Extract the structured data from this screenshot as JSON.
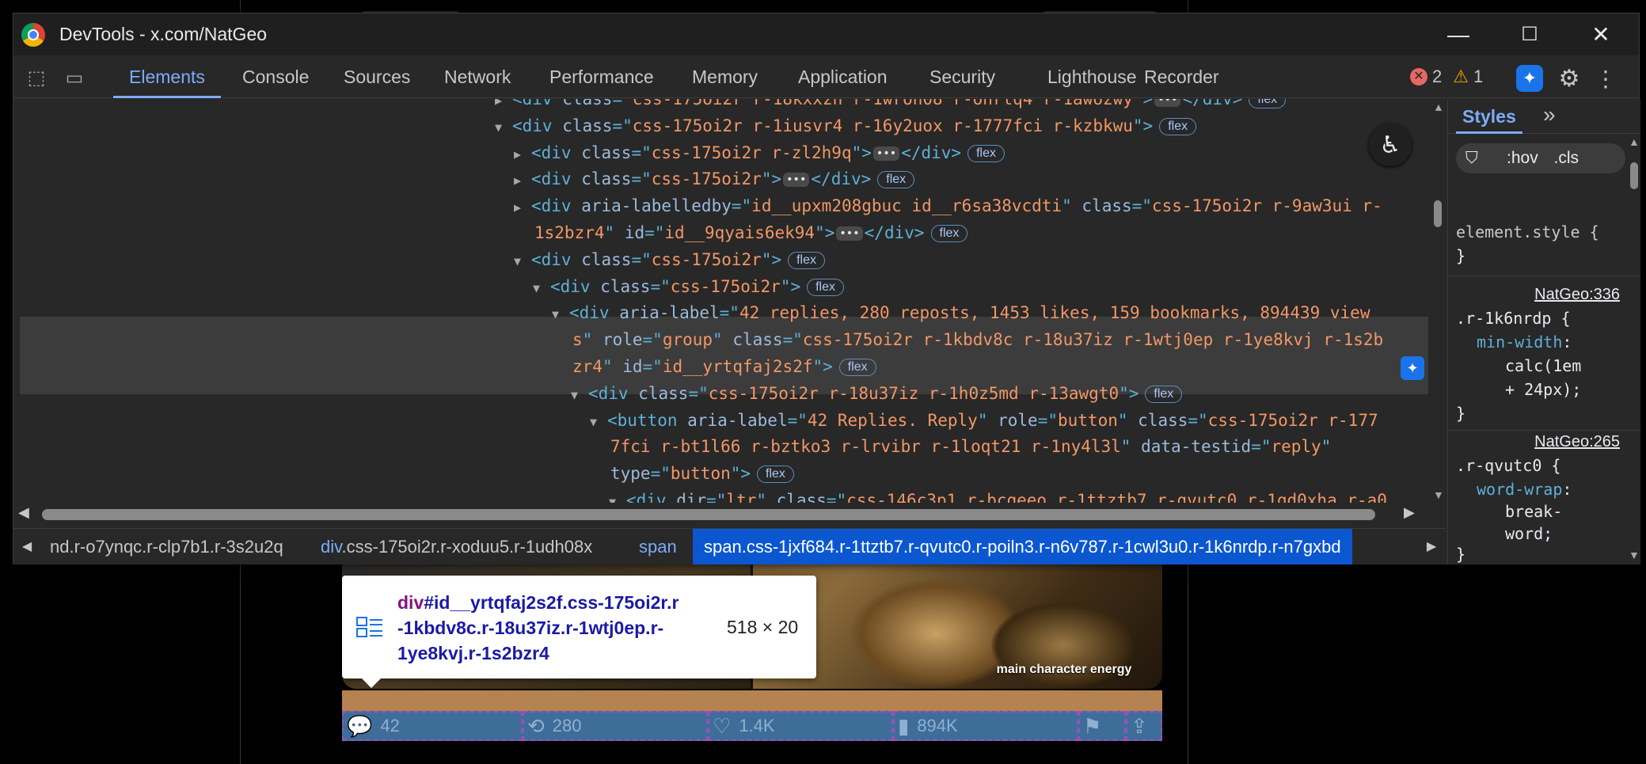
{
  "window": {
    "title": "DevTools - x.com/NatGeo",
    "minimize": "—",
    "maximize": "☐",
    "close": "✕"
  },
  "tabs": [
    "Elements",
    "Console",
    "Sources",
    "Network",
    "Performance",
    "Memory",
    "Application",
    "Security",
    "Lighthouse",
    "Recorder"
  ],
  "status": {
    "errors": "2",
    "warnings": "1"
  },
  "elements": {
    "lines": [
      {
        "indent": 0,
        "tri": "▶",
        "html": [
          [
            "tg",
            "<div "
          ],
          [
            "at",
            "class"
          ],
          [
            "tg",
            "=\""
          ],
          [
            "av",
            "css-175oi2r r-18kxxzh r-1wron08 r-onrtq4 r-1awozwy"
          ],
          [
            "tg",
            "\">"
          ]
        ],
        "ell": true,
        "close": "</div>",
        "flex": true
      },
      {
        "indent": 0,
        "tri": "▼",
        "html": [
          [
            "tg",
            "<div "
          ],
          [
            "at",
            "class"
          ],
          [
            "tg",
            "=\""
          ],
          [
            "av",
            "css-175oi2r r-1iusvr4 r-16y2uox r-1777fci r-kzbkwu"
          ],
          [
            "tg",
            "\">"
          ]
        ],
        "ell": false,
        "close": "",
        "flex": true
      },
      {
        "indent": 1,
        "tri": "▶",
        "html": [
          [
            "tg",
            "<div "
          ],
          [
            "at",
            "class"
          ],
          [
            "tg",
            "=\""
          ],
          [
            "av",
            "css-175oi2r r-zl2h9q"
          ],
          [
            "tg",
            "\">"
          ]
        ],
        "ell": true,
        "close": "</div>",
        "flex": true
      },
      {
        "indent": 1,
        "tri": "▶",
        "html": [
          [
            "tg",
            "<div "
          ],
          [
            "at",
            "class"
          ],
          [
            "tg",
            "=\""
          ],
          [
            "av",
            "css-175oi2r"
          ],
          [
            "tg",
            "\">"
          ]
        ],
        "ell": true,
        "close": "</div>",
        "flex": true
      },
      {
        "indent": 1,
        "tri": "▶",
        "html": [
          [
            "tg",
            "<div "
          ],
          [
            "at",
            "aria-labelledby"
          ],
          [
            "tg",
            "=\""
          ],
          [
            "av",
            "id__upxm208gbuc id__r6sa38vcdti"
          ],
          [
            "tg",
            "\" "
          ],
          [
            "at",
            "class"
          ],
          [
            "tg",
            "=\""
          ],
          [
            "av",
            "css-175oi2r r-9aw3ui r-"
          ]
        ],
        "ell": false,
        "close": "",
        "flex": false
      },
      {
        "indent": 1,
        "tri": "",
        "html": [
          [
            "av",
            "1s2bzr4"
          ],
          [
            "tg",
            "\" "
          ],
          [
            "at",
            "id"
          ],
          [
            "tg",
            "=\""
          ],
          [
            "av",
            "id__9qyais6ek94"
          ],
          [
            "tg",
            "\">"
          ]
        ],
        "ell": true,
        "close": "</div>",
        "flex": true
      },
      {
        "indent": 1,
        "tri": "▼",
        "html": [
          [
            "tg",
            "<div "
          ],
          [
            "at",
            "class"
          ],
          [
            "tg",
            "=\""
          ],
          [
            "av",
            "css-175oi2r"
          ],
          [
            "tg",
            "\">"
          ]
        ],
        "ell": false,
        "close": "",
        "flex": true
      },
      {
        "indent": 2,
        "tri": "▼",
        "html": [
          [
            "tg",
            "<div "
          ],
          [
            "at",
            "class"
          ],
          [
            "tg",
            "=\""
          ],
          [
            "av",
            "css-175oi2r"
          ],
          [
            "tg",
            "\">"
          ]
        ],
        "ell": false,
        "close": "",
        "flex": true
      },
      {
        "indent": 3,
        "tri": "▼",
        "html": [
          [
            "tg",
            "<div "
          ],
          [
            "at",
            "aria-label"
          ],
          [
            "tg",
            "=\""
          ],
          [
            "av",
            "42 replies, 280 reposts, 1453 likes, 159 bookmarks, 894439 view"
          ]
        ],
        "ell": false,
        "close": "",
        "flex": false
      },
      {
        "indent": 3,
        "tri": "",
        "html": [
          [
            "av",
            "s"
          ],
          [
            "tg",
            "\" "
          ],
          [
            "at",
            "role"
          ],
          [
            "tg",
            "=\""
          ],
          [
            "av",
            "group"
          ],
          [
            "tg",
            "\" "
          ],
          [
            "at",
            "class"
          ],
          [
            "tg",
            "=\""
          ],
          [
            "av",
            "css-175oi2r r-1kbdv8c r-18u37iz r-1wtj0ep r-1ye8kvj r-1s2b"
          ]
        ],
        "ell": false,
        "close": "",
        "flex": false
      },
      {
        "indent": 3,
        "tri": "",
        "html": [
          [
            "av",
            "zr4"
          ],
          [
            "tg",
            "\" "
          ],
          [
            "at",
            "id"
          ],
          [
            "tg",
            "=\""
          ],
          [
            "av",
            "id__yrtqfaj2s2f"
          ],
          [
            "tg",
            "\">"
          ]
        ],
        "ell": false,
        "close": "",
        "flex": true
      },
      {
        "indent": 4,
        "tri": "▼",
        "html": [
          [
            "tg",
            "<div "
          ],
          [
            "at",
            "class"
          ],
          [
            "tg",
            "=\""
          ],
          [
            "av",
            "css-175oi2r r-18u37iz r-1h0z5md r-13awgt0"
          ],
          [
            "tg",
            "\">"
          ]
        ],
        "ell": false,
        "close": "",
        "flex": true
      },
      {
        "indent": 5,
        "tri": "▼",
        "html": [
          [
            "tg",
            "<button "
          ],
          [
            "at",
            "aria-label"
          ],
          [
            "tg",
            "=\""
          ],
          [
            "av",
            "42 Replies. Reply"
          ],
          [
            "tg",
            "\" "
          ],
          [
            "at",
            "role"
          ],
          [
            "tg",
            "=\""
          ],
          [
            "av",
            "button"
          ],
          [
            "tg",
            "\" "
          ],
          [
            "at",
            "class"
          ],
          [
            "tg",
            "=\""
          ],
          [
            "av",
            "css-175oi2r r-177"
          ]
        ],
        "ell": false,
        "close": "",
        "flex": false
      },
      {
        "indent": 5,
        "tri": "",
        "html": [
          [
            "av",
            "7fci r-bt1l66 r-bztko3 r-lrvibr r-1loqt21 r-1ny4l3l"
          ],
          [
            "tg",
            "\" "
          ],
          [
            "at",
            "data-testid"
          ],
          [
            "tg",
            "=\""
          ],
          [
            "av",
            "reply"
          ],
          [
            "tg",
            "\""
          ]
        ],
        "ell": false,
        "close": "",
        "flex": false
      },
      {
        "indent": 5,
        "tri": "",
        "html": [
          [
            "at",
            "type"
          ],
          [
            "tg",
            "=\""
          ],
          [
            "av",
            "button"
          ],
          [
            "tg",
            "\">"
          ]
        ],
        "ell": false,
        "close": "",
        "flex": true
      },
      {
        "indent": 6,
        "tri": "▼",
        "html": [
          [
            "tg",
            "<div "
          ],
          [
            "at",
            "dir"
          ],
          [
            "tg",
            "=\""
          ],
          [
            "av",
            "ltr"
          ],
          [
            "tg",
            "\" "
          ],
          [
            "at",
            "class"
          ],
          [
            "tg",
            "=\""
          ],
          [
            "av",
            "css-146c3p1 r-bcqeeo r-1ttztb7 r-qvutc0 r-1qd0xha r-a0"
          ]
        ],
        "ell": false,
        "close": "",
        "flex": false
      }
    ],
    "flex_label": "flex"
  },
  "breadcrumbs": [
    {
      "tag": "",
      "cls": "nd.r-o7ynqc.r-clp7b1.r-3s2u2q"
    },
    {
      "tag": "div",
      "cls": ".css-175oi2r.r-xoduu5.r-1udh08x"
    },
    {
      "tag": "span",
      "cls": ""
    },
    {
      "tag": "span",
      "cls": ".css-1jxf684.r-1ttztb7.r-qvutc0.r-poiln3.r-n6v787.r-1cwl3u0.r-1k6nrdp.r-n7gxbd"
    }
  ],
  "styles": {
    "tab": "Styles",
    "more": "»",
    "filter_hov": ":hov",
    "filter_cls": ".cls",
    "element_style": "element.style {",
    "brace_close": "}",
    "rules": [
      {
        "source": "NatGeo:336",
        "selector": ".r-1k6nrdp {",
        "prop": "min-width",
        "values": [
          "calc(1em",
          "+ 24px);"
        ]
      },
      {
        "source": "NatGeo:265",
        "selector": ".r-qvutc0 {",
        "prop": "word-wrap",
        "values": [
          "break-",
          "word;"
        ]
      }
    ]
  },
  "tooltip": {
    "tag": "div",
    "id": "#id__yrtqfaj2s2f",
    "line1": ".css-175oi2r.r",
    "line2": "-1kbdv8c.r-18u37iz.r-1wtj0ep.r-",
    "line3": "1ye8kvj.r-1s2bzr4",
    "size": "518 × 20"
  },
  "tweet": {
    "caption": "main character energy",
    "actions": [
      {
        "name": "reply",
        "icon": "💬",
        "count": "42"
      },
      {
        "name": "repost",
        "icon": "⟲",
        "count": "280"
      },
      {
        "name": "like",
        "icon": "♡",
        "count": "1.4K"
      },
      {
        "name": "views",
        "icon": "▮",
        "count": "894K"
      },
      {
        "name": "bookmark",
        "icon": "⚑",
        "count": ""
      },
      {
        "name": "share",
        "icon": "⇪",
        "count": ""
      }
    ]
  }
}
